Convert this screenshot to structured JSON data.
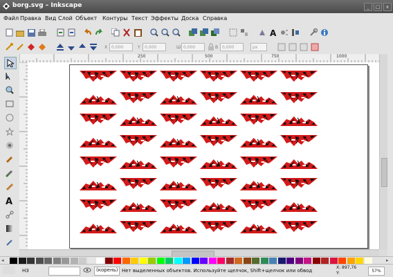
{
  "window": {
    "title": "borg.svg – Inkscape"
  },
  "menu": [
    "Файл",
    "Правка",
    "Вид",
    "Слой",
    "Объект",
    "Контуры",
    "Текст",
    "Эффекты",
    "Доска",
    "Справка"
  ],
  "toolbar": {
    "x_label": "X",
    "x_value": "0,000",
    "y_label": "Y",
    "y_value": "0,000",
    "w_label": "Ш",
    "w_value": "0,000",
    "h_label": "В",
    "h_value": "0,000",
    "units_value": "px"
  },
  "ruler": {
    "ticks": [
      "250",
      "500",
      "750",
      "1000"
    ]
  },
  "statusbar": {
    "fill_label": "НЗ",
    "layer": "(корень)",
    "message": "Нет выделенных объектов. Используйте щелчок, Shift+щелчок или обвод",
    "coords": "X: 897,76",
    "y_coord": "Y: ",
    "zoom": "57%"
  },
  "colors": {
    "ornament_red": "#d41a1a",
    "ornament_black": "#111111"
  },
  "canvas": {
    "rows": 8,
    "cols": 6,
    "element": "embroidery-ornament"
  }
}
